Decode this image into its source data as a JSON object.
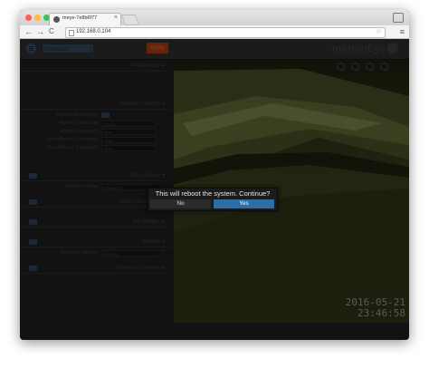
{
  "browser": {
    "tab_title": "meye-7e8b6f77",
    "tab_close": "×",
    "url": "192.168.0.104",
    "back": "←",
    "forward": "→",
    "reload": "C",
    "star": "☆",
    "menu": "≡"
  },
  "app": {
    "camera_select": "Camera1",
    "camera_select_arrow": "▾",
    "apply_label": "Apply",
    "logo": "motionEye"
  },
  "settings": {
    "preferences": "Preferences ▸",
    "general_settings": "General Settings ▾",
    "advanced_settings_label": "Advanced Settings",
    "admin_username_label": "Admin Username",
    "admin_username_value": "admin",
    "admin_password_label": "Admin Password",
    "admin_password_value": "••••••",
    "surveillance_username_label": "Surveillance Username",
    "surveillance_username_value": "user",
    "surveillance_password_label": "Surveillance Password",
    "surveillance_password_value": "••••••",
    "video_device": "Video Device ▾",
    "camera_name_label": "Camera Name",
    "camera_name_value": "Camera1",
    "video_streaming": "Video Streaming ▸",
    "still_images": "Still Images ▸",
    "movies": "Movies ▾",
    "preserve_movies_label": "Preserve Movies",
    "preserve_movies_value": "Forever",
    "preserve_movies_arrow": "▾",
    "working_schedule": "Working Schedule ▸"
  },
  "camera": {
    "timestamp_date": "2016-05-21",
    "timestamp_time": "23:46:58"
  },
  "dialog": {
    "message": "This will reboot the system. Continue?",
    "no_label": "No",
    "yes_label": "Yes"
  },
  "colors": {
    "accent_blue": "#2e6da4",
    "apply_orange": "#9a3612",
    "page_background": "#1d1d1d"
  }
}
